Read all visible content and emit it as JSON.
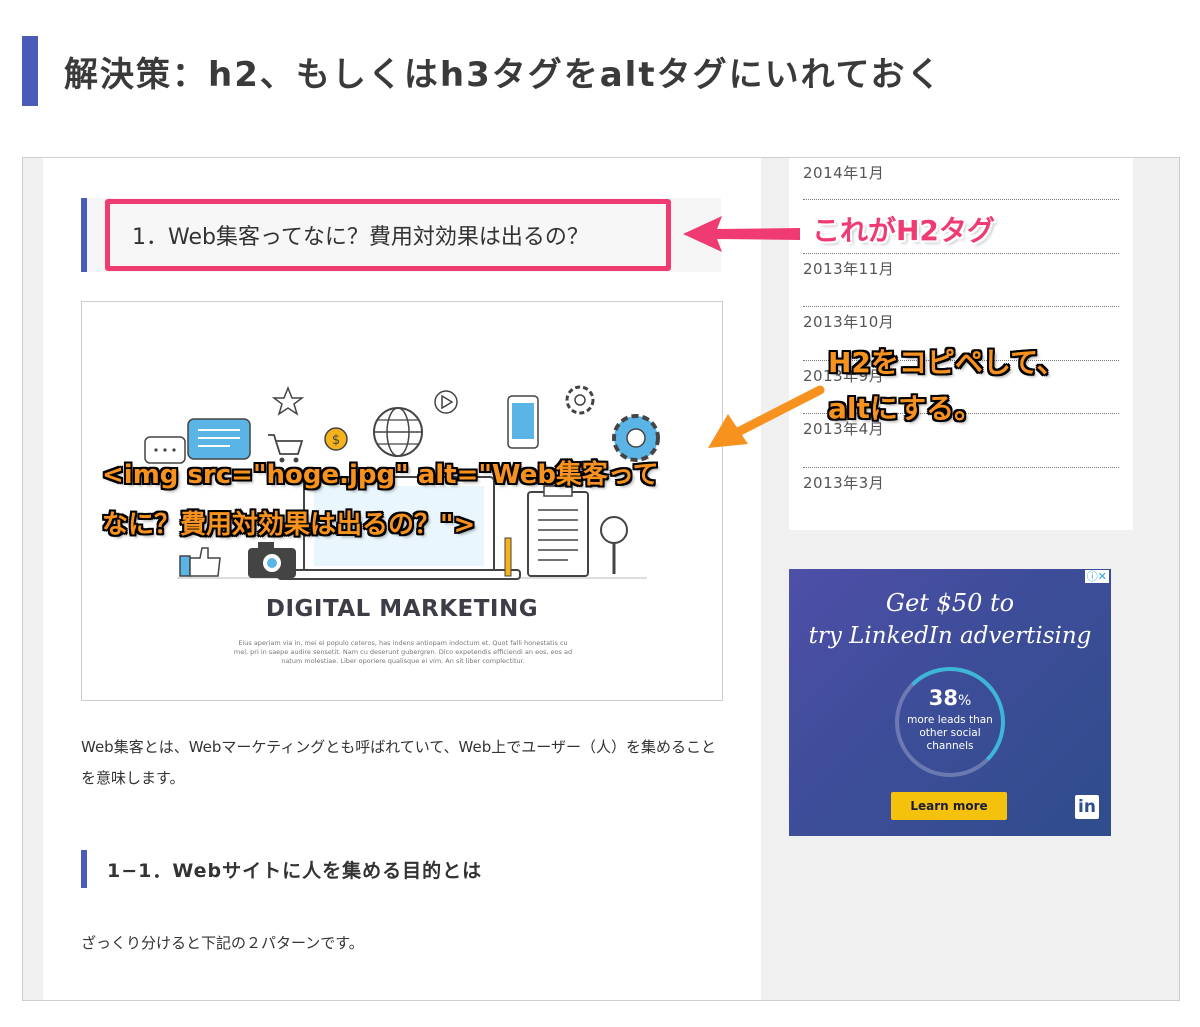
{
  "heading": {
    "title": "解決策：h2、もしくはh3タグをaltタグにいれておく",
    "accent": "#4a5cb8"
  },
  "article": {
    "h2_title": "1．Web集客ってなに？費用対効果は出るの？",
    "hero_title": "DIGITAL MARKETING",
    "hero_lorem": "Eius aperiam via in, mei ei populo ceteros, has indens antiopam indoctum et. Quot falli honestatis cu mel, pri in saepe audire sensetit. Nam cu deserunt gubergren. Dico expetendis efficiendi an eos, eos ad natum molestiae. Liber oporiere qualisque ei vim. An sit liber complectitur.",
    "paragraph1": "Web集客とは、Webマーケティングとも呼ばれていて、Web上でユーザー（人）を集めることを意味します。",
    "h3_title": "1−1．Webサイトに人を集める目的とは",
    "paragraph2": "ざっくり分けると下記の２パターンです。"
  },
  "sidebar": {
    "archive": [
      "2014年1月",
      "",
      "2013年11月",
      "2013年10月",
      "2013年9月",
      "2013年4月",
      "2013年3月"
    ]
  },
  "ad": {
    "line1": "Get $50 to",
    "line2": "try LinkedIn advertising",
    "percent": "38",
    "percent_sign": "%",
    "sub": "more leads than other social channels",
    "cta": "Learn more",
    "logo": "in",
    "icons": "ⓘ✕"
  },
  "annotations": {
    "h2_label": "これがH2タグ",
    "copy_line1": "H2をコピペして、",
    "copy_line2": "altにする。",
    "code_line1": "<img src=\"hoge.jpg\" alt=\"Web集客って",
    "code_line2": "なに？費用対効果は出るの？\">",
    "pink": "#ef3a72",
    "orange": "#f7921e"
  }
}
